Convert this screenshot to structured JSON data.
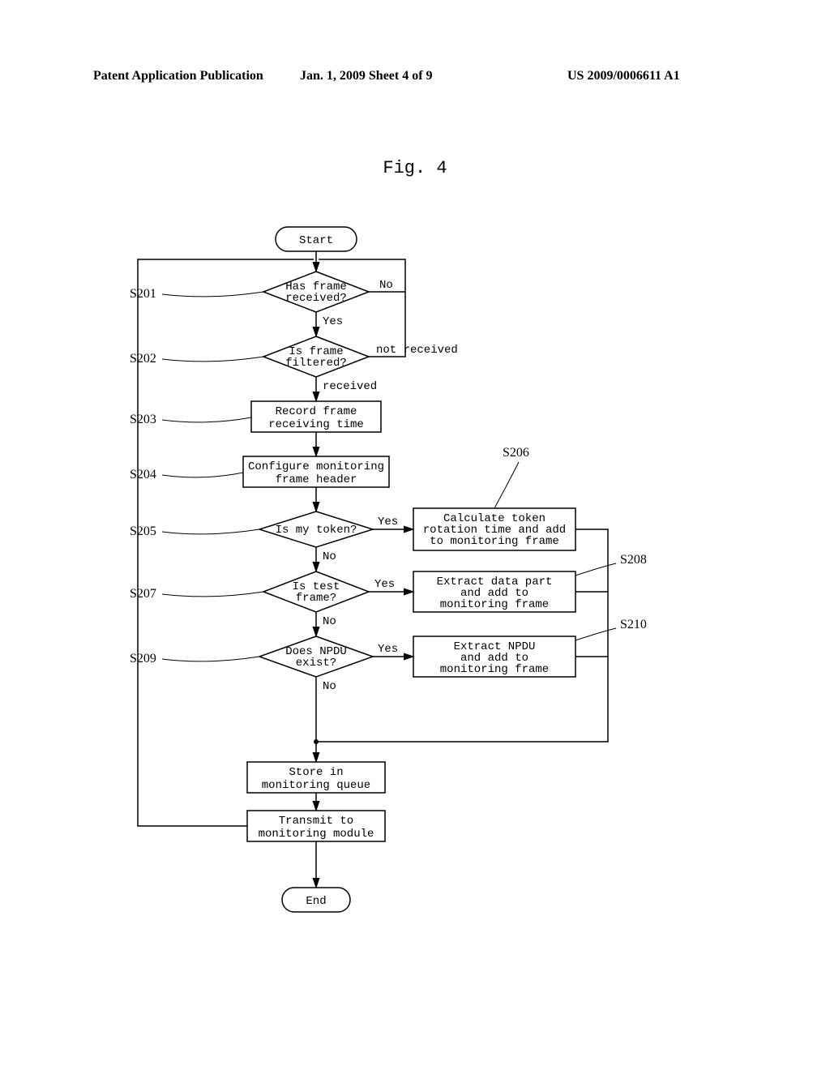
{
  "header": {
    "left": "Patent Application Publication",
    "mid": "Jan. 1, 2009   Sheet 4 of 9",
    "right": "US 2009/0006611 A1"
  },
  "fig_label": "Fig. 4",
  "nodes": {
    "start": "Start",
    "end": "End",
    "s201": {
      "ref": "S201",
      "text1": "Has frame",
      "text2": "received?",
      "no": "No",
      "yes": "Yes"
    },
    "s202": {
      "ref": "S202",
      "text1": "Is frame",
      "text2": "filtered?",
      "no": "not received",
      "yes": "received"
    },
    "s203": {
      "ref": "S203",
      "text1": "Record frame",
      "text2": "receiving time"
    },
    "s204": {
      "ref": "S204",
      "text1": "Configure monitoring",
      "text2": "frame header"
    },
    "s205": {
      "ref": "S205",
      "text": "Is my token?",
      "no": "No",
      "yes": "Yes"
    },
    "s206": {
      "ref": "S206",
      "text1": "Calculate token",
      "text2": "rotation time and add",
      "text3": "to monitoring frame"
    },
    "s207": {
      "ref": "S207",
      "text1": "Is test",
      "text2": "frame?",
      "no": "No",
      "yes": "Yes"
    },
    "s208": {
      "ref": "S208",
      "text1": "Extract data part",
      "text2": "and add to",
      "text3": "monitoring frame"
    },
    "s209": {
      "ref": "S209",
      "text1": "Does NPDU",
      "text2": "exist?",
      "no": "No",
      "yes": "Yes"
    },
    "s210": {
      "ref": "S210",
      "text1": "Extract NPDU",
      "text2": "and add to",
      "text3": "monitoring frame"
    },
    "store": {
      "text1": "Store in",
      "text2": "monitoring queue"
    },
    "transmit": {
      "text1": "Transmit to",
      "text2": "monitoring module"
    }
  },
  "chart_data": {
    "type": "flowchart",
    "title": "Fig. 4",
    "nodes": [
      {
        "id": "start",
        "type": "terminator",
        "label": "Start"
      },
      {
        "id": "S201",
        "type": "decision",
        "label": "Has frame received?"
      },
      {
        "id": "S202",
        "type": "decision",
        "label": "Is frame filtered?"
      },
      {
        "id": "S203",
        "type": "process",
        "label": "Record frame receiving time"
      },
      {
        "id": "S204",
        "type": "process",
        "label": "Configure monitoring frame header"
      },
      {
        "id": "S205",
        "type": "decision",
        "label": "Is my token?"
      },
      {
        "id": "S206",
        "type": "process",
        "label": "Calculate token rotation time and add to monitoring frame"
      },
      {
        "id": "S207",
        "type": "decision",
        "label": "Is test frame?"
      },
      {
        "id": "S208",
        "type": "process",
        "label": "Extract data part and add to monitoring frame"
      },
      {
        "id": "S209",
        "type": "decision",
        "label": "Does NPDU exist?"
      },
      {
        "id": "S210",
        "type": "process",
        "label": "Extract NPDU and add to monitoring frame"
      },
      {
        "id": "store",
        "type": "process",
        "label": "Store in monitoring queue"
      },
      {
        "id": "transmit",
        "type": "process",
        "label": "Transmit to monitoring module"
      },
      {
        "id": "end",
        "type": "terminator",
        "label": "End"
      }
    ],
    "edges": [
      {
        "from": "start",
        "to": "S201"
      },
      {
        "from": "S201",
        "to": "S201",
        "label": "No",
        "loop": true
      },
      {
        "from": "S201",
        "to": "S202",
        "label": "Yes"
      },
      {
        "from": "S202",
        "to": "S201",
        "label": "not received",
        "loop": true
      },
      {
        "from": "S202",
        "to": "S203",
        "label": "received"
      },
      {
        "from": "S203",
        "to": "S204"
      },
      {
        "from": "S204",
        "to": "S205"
      },
      {
        "from": "S205",
        "to": "S206",
        "label": "Yes"
      },
      {
        "from": "S205",
        "to": "S207",
        "label": "No"
      },
      {
        "from": "S207",
        "to": "S208",
        "label": "Yes"
      },
      {
        "from": "S207",
        "to": "S209",
        "label": "No"
      },
      {
        "from": "S209",
        "to": "S210",
        "label": "Yes"
      },
      {
        "from": "S209",
        "to": "store",
        "label": "No"
      },
      {
        "from": "S206",
        "to": "store"
      },
      {
        "from": "S208",
        "to": "store"
      },
      {
        "from": "S210",
        "to": "store"
      },
      {
        "from": "store",
        "to": "transmit"
      },
      {
        "from": "transmit",
        "to": "S201",
        "loop": true
      },
      {
        "from": "transmit",
        "to": "end"
      }
    ]
  }
}
